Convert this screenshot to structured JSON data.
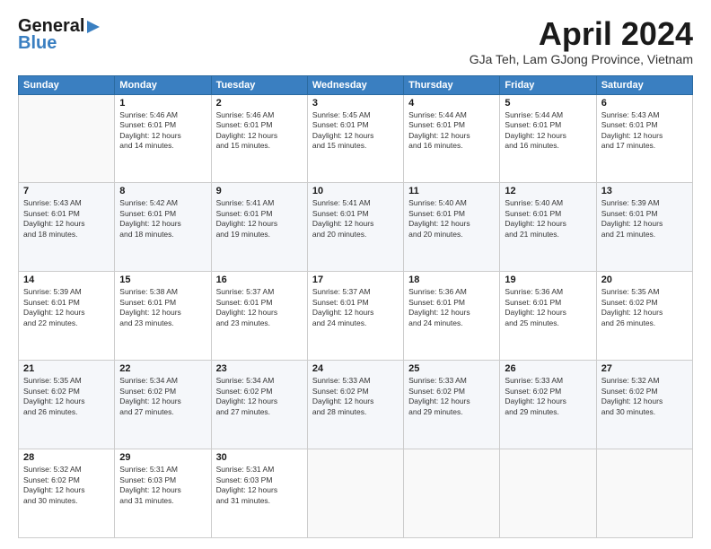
{
  "header": {
    "logo_line1": "General",
    "logo_line2": "Blue",
    "title": "April 2024",
    "location": "GJa Teh, Lam GJong Province, Vietnam"
  },
  "days_of_week": [
    "Sunday",
    "Monday",
    "Tuesday",
    "Wednesday",
    "Thursday",
    "Friday",
    "Saturday"
  ],
  "weeks": [
    [
      {
        "day": "",
        "info": ""
      },
      {
        "day": "1",
        "info": "Sunrise: 5:46 AM\nSunset: 6:01 PM\nDaylight: 12 hours\nand 14 minutes."
      },
      {
        "day": "2",
        "info": "Sunrise: 5:46 AM\nSunset: 6:01 PM\nDaylight: 12 hours\nand 15 minutes."
      },
      {
        "day": "3",
        "info": "Sunrise: 5:45 AM\nSunset: 6:01 PM\nDaylight: 12 hours\nand 15 minutes."
      },
      {
        "day": "4",
        "info": "Sunrise: 5:44 AM\nSunset: 6:01 PM\nDaylight: 12 hours\nand 16 minutes."
      },
      {
        "day": "5",
        "info": "Sunrise: 5:44 AM\nSunset: 6:01 PM\nDaylight: 12 hours\nand 16 minutes."
      },
      {
        "day": "6",
        "info": "Sunrise: 5:43 AM\nSunset: 6:01 PM\nDaylight: 12 hours\nand 17 minutes."
      }
    ],
    [
      {
        "day": "7",
        "info": "Sunrise: 5:43 AM\nSunset: 6:01 PM\nDaylight: 12 hours\nand 18 minutes."
      },
      {
        "day": "8",
        "info": "Sunrise: 5:42 AM\nSunset: 6:01 PM\nDaylight: 12 hours\nand 18 minutes."
      },
      {
        "day": "9",
        "info": "Sunrise: 5:41 AM\nSunset: 6:01 PM\nDaylight: 12 hours\nand 19 minutes."
      },
      {
        "day": "10",
        "info": "Sunrise: 5:41 AM\nSunset: 6:01 PM\nDaylight: 12 hours\nand 20 minutes."
      },
      {
        "day": "11",
        "info": "Sunrise: 5:40 AM\nSunset: 6:01 PM\nDaylight: 12 hours\nand 20 minutes."
      },
      {
        "day": "12",
        "info": "Sunrise: 5:40 AM\nSunset: 6:01 PM\nDaylight: 12 hours\nand 21 minutes."
      },
      {
        "day": "13",
        "info": "Sunrise: 5:39 AM\nSunset: 6:01 PM\nDaylight: 12 hours\nand 21 minutes."
      }
    ],
    [
      {
        "day": "14",
        "info": "Sunrise: 5:39 AM\nSunset: 6:01 PM\nDaylight: 12 hours\nand 22 minutes."
      },
      {
        "day": "15",
        "info": "Sunrise: 5:38 AM\nSunset: 6:01 PM\nDaylight: 12 hours\nand 23 minutes."
      },
      {
        "day": "16",
        "info": "Sunrise: 5:37 AM\nSunset: 6:01 PM\nDaylight: 12 hours\nand 23 minutes."
      },
      {
        "day": "17",
        "info": "Sunrise: 5:37 AM\nSunset: 6:01 PM\nDaylight: 12 hours\nand 24 minutes."
      },
      {
        "day": "18",
        "info": "Sunrise: 5:36 AM\nSunset: 6:01 PM\nDaylight: 12 hours\nand 24 minutes."
      },
      {
        "day": "19",
        "info": "Sunrise: 5:36 AM\nSunset: 6:01 PM\nDaylight: 12 hours\nand 25 minutes."
      },
      {
        "day": "20",
        "info": "Sunrise: 5:35 AM\nSunset: 6:02 PM\nDaylight: 12 hours\nand 26 minutes."
      }
    ],
    [
      {
        "day": "21",
        "info": "Sunrise: 5:35 AM\nSunset: 6:02 PM\nDaylight: 12 hours\nand 26 minutes."
      },
      {
        "day": "22",
        "info": "Sunrise: 5:34 AM\nSunset: 6:02 PM\nDaylight: 12 hours\nand 27 minutes."
      },
      {
        "day": "23",
        "info": "Sunrise: 5:34 AM\nSunset: 6:02 PM\nDaylight: 12 hours\nand 27 minutes."
      },
      {
        "day": "24",
        "info": "Sunrise: 5:33 AM\nSunset: 6:02 PM\nDaylight: 12 hours\nand 28 minutes."
      },
      {
        "day": "25",
        "info": "Sunrise: 5:33 AM\nSunset: 6:02 PM\nDaylight: 12 hours\nand 29 minutes."
      },
      {
        "day": "26",
        "info": "Sunrise: 5:33 AM\nSunset: 6:02 PM\nDaylight: 12 hours\nand 29 minutes."
      },
      {
        "day": "27",
        "info": "Sunrise: 5:32 AM\nSunset: 6:02 PM\nDaylight: 12 hours\nand 30 minutes."
      }
    ],
    [
      {
        "day": "28",
        "info": "Sunrise: 5:32 AM\nSunset: 6:02 PM\nDaylight: 12 hours\nand 30 minutes."
      },
      {
        "day": "29",
        "info": "Sunrise: 5:31 AM\nSunset: 6:03 PM\nDaylight: 12 hours\nand 31 minutes."
      },
      {
        "day": "30",
        "info": "Sunrise: 5:31 AM\nSunset: 6:03 PM\nDaylight: 12 hours\nand 31 minutes."
      },
      {
        "day": "",
        "info": ""
      },
      {
        "day": "",
        "info": ""
      },
      {
        "day": "",
        "info": ""
      },
      {
        "day": "",
        "info": ""
      }
    ]
  ]
}
